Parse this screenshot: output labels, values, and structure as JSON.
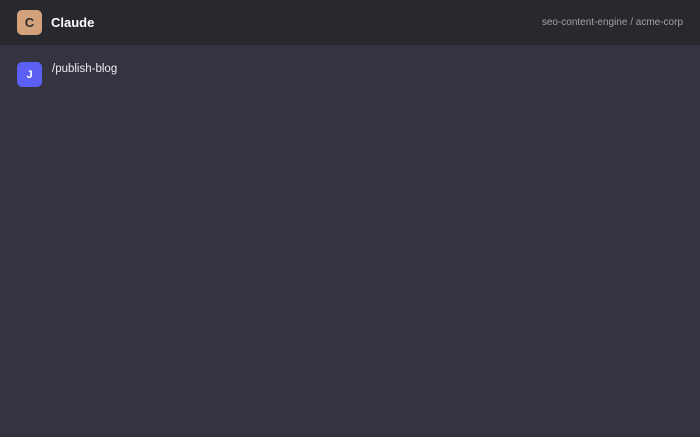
{
  "header": {
    "logo_letter": "C",
    "title": "Claude",
    "context": "seo-content-engine / acme-corp"
  },
  "messages": [
    {
      "avatar_letter": "J",
      "text": "/publish-blog"
    }
  ],
  "colors": {
    "background": "#343440",
    "header_background": "#28292e",
    "claude_avatar": "#d4a27a",
    "user_avatar": "#5b5ff3"
  }
}
